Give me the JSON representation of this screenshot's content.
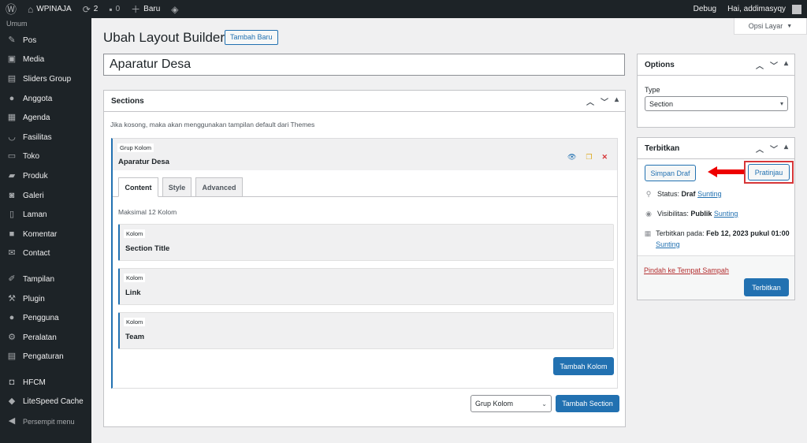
{
  "adminbar": {
    "site_name": "WPINAJA",
    "updates_count": "2",
    "comments_count": "0",
    "new_label": "Baru",
    "debug_label": "Debug",
    "greeting": "Hai, addimasyqy"
  },
  "sidebar": {
    "top_label": "Umum",
    "items": [
      {
        "label": "Pos",
        "icon": "pin-icon"
      },
      {
        "label": "Media",
        "icon": "media-icon"
      },
      {
        "label": "Sliders Group",
        "icon": "slides-icon"
      },
      {
        "label": "Anggota",
        "icon": "person-icon"
      },
      {
        "label": "Agenda",
        "icon": "calendar-icon"
      },
      {
        "label": "Fasilitas",
        "icon": "smile-icon"
      },
      {
        "label": "Toko",
        "icon": "store-icon"
      },
      {
        "label": "Produk",
        "icon": "archive-icon"
      },
      {
        "label": "Galeri",
        "icon": "camera-icon"
      },
      {
        "label": "Laman",
        "icon": "page-icon"
      },
      {
        "label": "Komentar",
        "icon": "comment-icon"
      },
      {
        "label": "Contact",
        "icon": "mail-icon"
      },
      {
        "label": "Tampilan",
        "icon": "brush-icon"
      },
      {
        "label": "Plugin",
        "icon": "plugin-icon"
      },
      {
        "label": "Pengguna",
        "icon": "users-icon"
      },
      {
        "label": "Peralatan",
        "icon": "wrench-icon"
      },
      {
        "label": "Pengaturan",
        "icon": "settings-icon"
      },
      {
        "label": "HFCM",
        "icon": "robot-icon"
      },
      {
        "label": "LiteSpeed Cache",
        "icon": "diamond-icon"
      }
    ],
    "collapse_label": "Persempit menu"
  },
  "screen_options_label": "Opsi Layar",
  "page": {
    "title": "Ubah Layout Builder",
    "add_new_label": "Tambah Baru",
    "post_title": "Aparatur Desa"
  },
  "sections_box": {
    "title": "Sections",
    "hint": "Jika kosong, maka akan menggunakan tampilan default dari Themes",
    "group": {
      "tag": "Grup Kolom",
      "title": "Aparatur Desa",
      "tabs": [
        "Content",
        "Style",
        "Advanced"
      ],
      "max_note": "Maksimal 12 Kolom",
      "columns": [
        {
          "tag": "Kolom",
          "title": "Section Title"
        },
        {
          "tag": "Kolom",
          "title": "Link"
        },
        {
          "tag": "Kolom",
          "title": "Team"
        }
      ],
      "add_column_label": "Tambah Kolom"
    },
    "type_select_value": "Grup Kolom",
    "add_section_label": "Tambah Section"
  },
  "options_box": {
    "title": "Options",
    "type_label": "Type",
    "type_value": "Section"
  },
  "publish_box": {
    "title": "Terbitkan",
    "save_draft_label": "Simpan Draf",
    "preview_label": "Pratinjau",
    "status_label": "Status:",
    "status_value": "Draf",
    "visibility_label": "Visibilitas:",
    "visibility_value": "Publik",
    "published_label": "Terbitkan pada:",
    "published_value": "Feb 12, 2023 pukul 01:00",
    "edit_link": "Sunting",
    "trash_label": "Pindah ke Tempat Sampah",
    "publish_label": "Terbitkan"
  },
  "colors": {
    "accent": "#2271b1",
    "admin_dark": "#1d2327",
    "highlight_red": "#d63638"
  }
}
